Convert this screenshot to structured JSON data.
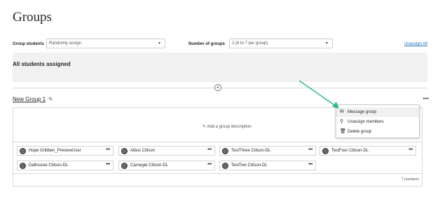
{
  "page": {
    "title": "Groups"
  },
  "controls": {
    "group_students_label": "Group students",
    "group_students_value": "Randomly assign",
    "number_groups_label": "Number of groups",
    "number_groups_value": "2 (6 to 7 per group)",
    "unassign_all": "Unassign All"
  },
  "status": {
    "assigned_text": "All students assigned"
  },
  "group": {
    "title": "New Group 1",
    "description_link": "Add a group description",
    "member_count": "7 members",
    "members": [
      {
        "name": "Hope Gribben_PreviewUser"
      },
      {
        "name": "Albus Ctilson"
      },
      {
        "name": "TestThree Ctilson-DL"
      },
      {
        "name": "TestFour Ctilson-DL"
      },
      {
        "name": "Dalhousie Ctilson-DL"
      },
      {
        "name": "Carnegie Ctilson-DL"
      },
      {
        "name": "TestTwo Ctilson-DL"
      }
    ]
  },
  "menu": {
    "items": [
      {
        "label": "Message group",
        "icon": "envelope-icon"
      },
      {
        "label": "Unassign members",
        "icon": "user-remove-icon"
      },
      {
        "label": "Delete group",
        "icon": "trash-icon"
      }
    ]
  },
  "colors": {
    "link": "#1b6fb8",
    "arrow": "#2fb890",
    "panel": "#f1f1f1"
  }
}
